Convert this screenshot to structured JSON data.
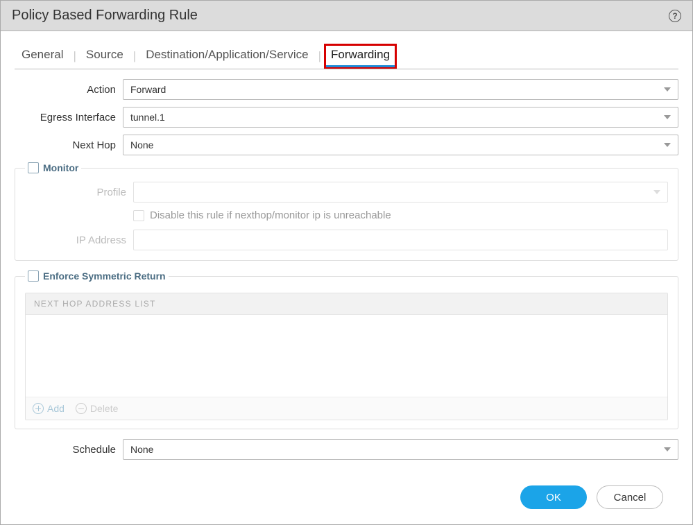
{
  "header": {
    "title": "Policy Based Forwarding Rule"
  },
  "tabs": {
    "general": "General",
    "source": "Source",
    "dest": "Destination/Application/Service",
    "forwarding": "Forwarding"
  },
  "form": {
    "action_label": "Action",
    "action_value": "Forward",
    "egress_label": "Egress Interface",
    "egress_value": "tunnel.1",
    "nexthop_label": "Next Hop",
    "nexthop_value": "None",
    "schedule_label": "Schedule",
    "schedule_value": "None"
  },
  "monitor": {
    "legend": "Monitor",
    "profile_label": "Profile",
    "profile_value": "",
    "disable_rule_label": "Disable this rule if nexthop/monitor ip is unreachable",
    "ip_label": "IP Address",
    "ip_value": ""
  },
  "symmetric": {
    "legend": "Enforce Symmetric Return",
    "list_header": "NEXT HOP ADDRESS LIST",
    "add_label": "Add",
    "delete_label": "Delete"
  },
  "footer": {
    "ok": "OK",
    "cancel": "Cancel"
  }
}
